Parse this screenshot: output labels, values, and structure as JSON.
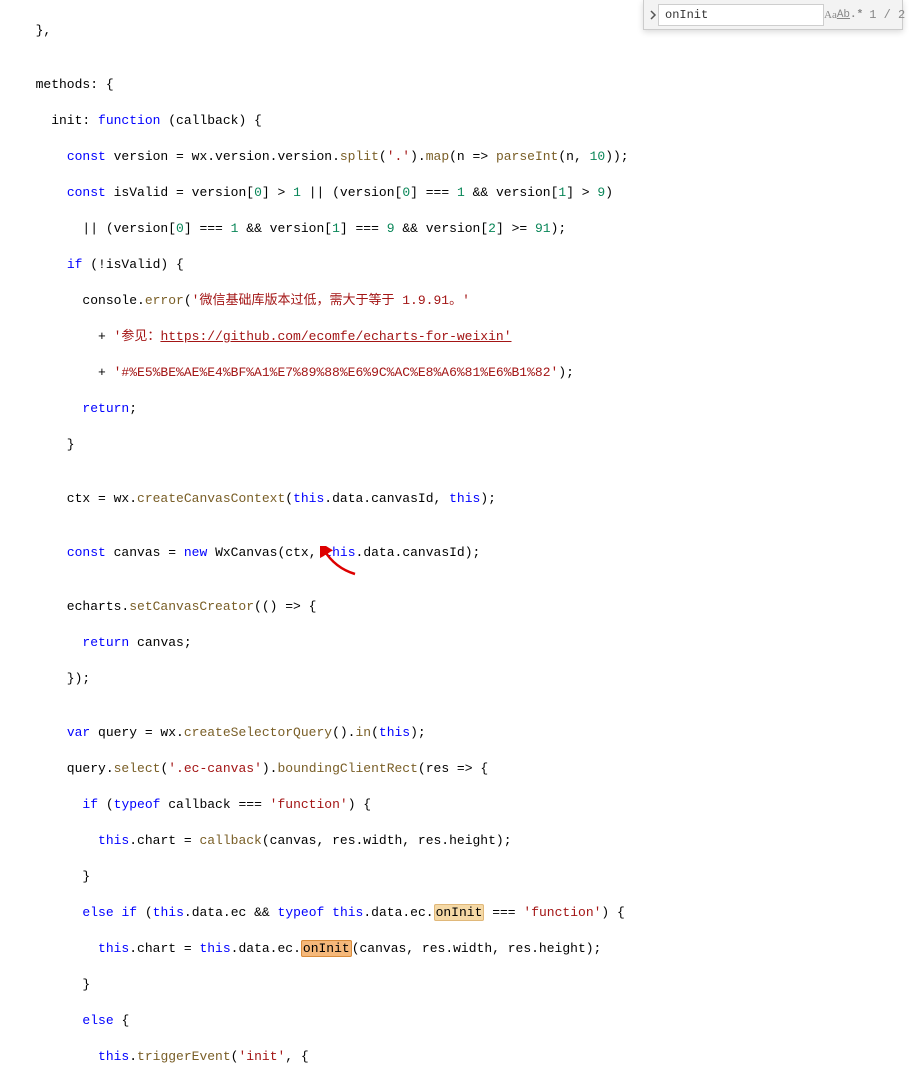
{
  "find": {
    "value": "onInit",
    "count": "1 / 2"
  },
  "code": {
    "l1": "  },",
    "l2": "",
    "l3_a": "  methods: {",
    "l4_a": "    init: ",
    "l4_b": "function",
    "l4_c": " (callback) {",
    "l5_a": "      ",
    "l5_b": "const",
    "l5_c": " version = wx.version.version.",
    "l5_split": "split",
    "l5_d": "(",
    "l5_e": "'.'",
    "l5_f": ").",
    "l5_map": "map",
    "l5_g": "(n => ",
    "l5_parseInt": "parseInt",
    "l5_h": "(n, ",
    "l5_10": "10",
    "l5_i": "));",
    "l6_a": "      ",
    "l6_b": "const",
    "l6_c": " isValid = version[",
    "l6_0": "0",
    "l6_d": "] > ",
    "l6_1": "1",
    "l6_e": " || (version[",
    "l6_f": "] === ",
    "l6_g": " && version[",
    "l6_h": "] > ",
    "l6_9": "9",
    "l6_i": ")",
    "l7_a": "        || (version[",
    "l7_b": "] === ",
    "l7_c": " && version[",
    "l7_d": "] === ",
    "l7_e": " && version[",
    "l7_2": "2",
    "l7_f": "] >= ",
    "l7_91": "91",
    "l7_g": ");",
    "l8_a": "      ",
    "l8_if": "if",
    "l8_b": " (!isValid) {",
    "l9_a": "        console.",
    "l9_err": "error",
    "l9_b": "(",
    "l9_s": "'微信基础库版本过低，需大于等于 1.9.91。'",
    "l10_a": "          + ",
    "l10_s1": "'参见：",
    "l10_link": "https://github.com/ecomfe/echarts-for-weixin'",
    "l11_a": "          + ",
    "l11_s": "'#%E5%BE%AE%E4%BF%A1%E7%89%88%E6%9C%AC%E8%A6%81%E6%B1%82'",
    "l11_b": ");",
    "l12_a": "        ",
    "l12_ret": "return",
    "l12_b": ";",
    "l13": "      }",
    "l14": "",
    "l15_a": "      ctx = wx.",
    "l15_fn": "createCanvasContext",
    "l15_b": "(",
    "l15_this": "this",
    "l15_c": ".data.canvasId, ",
    "l15_d": ");",
    "l16": "",
    "l17_a": "      ",
    "l17_b": "const",
    "l17_c": " canvas = ",
    "l17_new": "new",
    "l17_d": " ",
    "l17_wxc": "WxCanvas",
    "l17_e": "(ctx, ",
    "l17_this": "this",
    "l17_f": ".data.canvasId);",
    "l18": "",
    "l19_a": "      echarts.",
    "l19_fn": "setCanvasCreator",
    "l19_b": "(() => {",
    "l20_a": "        ",
    "l20_ret": "return",
    "l20_b": " canvas;",
    "l21": "      });",
    "l22": "",
    "l23_a": "      ",
    "l23_var": "var",
    "l23_b": " query = wx.",
    "l23_fn": "createSelectorQuery",
    "l23_c": "().",
    "l23_in": "in",
    "l23_d": "(",
    "l23_this": "this",
    "l23_e": ");",
    "l24_a": "      query.",
    "l24_sel": "select",
    "l24_b": "(",
    "l24_s": "'.ec-canvas'",
    "l24_c": ").",
    "l24_bcr": "boundingClientRect",
    "l24_d": "(res => {",
    "l25_a": "        ",
    "l25_if": "if",
    "l25_b": " (",
    "l25_typeof": "typeof",
    "l25_c": " callback === ",
    "l25_s": "'function'",
    "l25_d": ") {",
    "l26_a": "          ",
    "l26_this": "this",
    "l26_b": ".chart = ",
    "l26_fn": "callback",
    "l26_c": "(canvas, res.width, res.height);",
    "l27": "        }",
    "l28_a": "        ",
    "l28_else": "else",
    "l28_b": " ",
    "l28_if": "if",
    "l28_c": " (",
    "l28_this": "this",
    "l28_d": ".data.ec && ",
    "l28_typeof": "typeof",
    "l28_e": " ",
    "l28_f": ".data.ec.",
    "l28_onInit": "onInit",
    "l28_g": " === ",
    "l28_s": "'function'",
    "l28_h": ") {",
    "l29_a": "          ",
    "l29_this": "this",
    "l29_b": ".chart = ",
    "l29_c": ".data.ec.",
    "l29_onInit": "onInit",
    "l29_d": "(canvas, res.width, res.height);",
    "l30": "        }",
    "l31_a": "        ",
    "l31_else": "else",
    "l31_b": " {",
    "l32_a": "          ",
    "l32_this": "this",
    "l32_b": ".",
    "l32_fn": "triggerEvent",
    "l32_c": "(",
    "l32_s": "'init'",
    "l32_d": ", {"
  }
}
